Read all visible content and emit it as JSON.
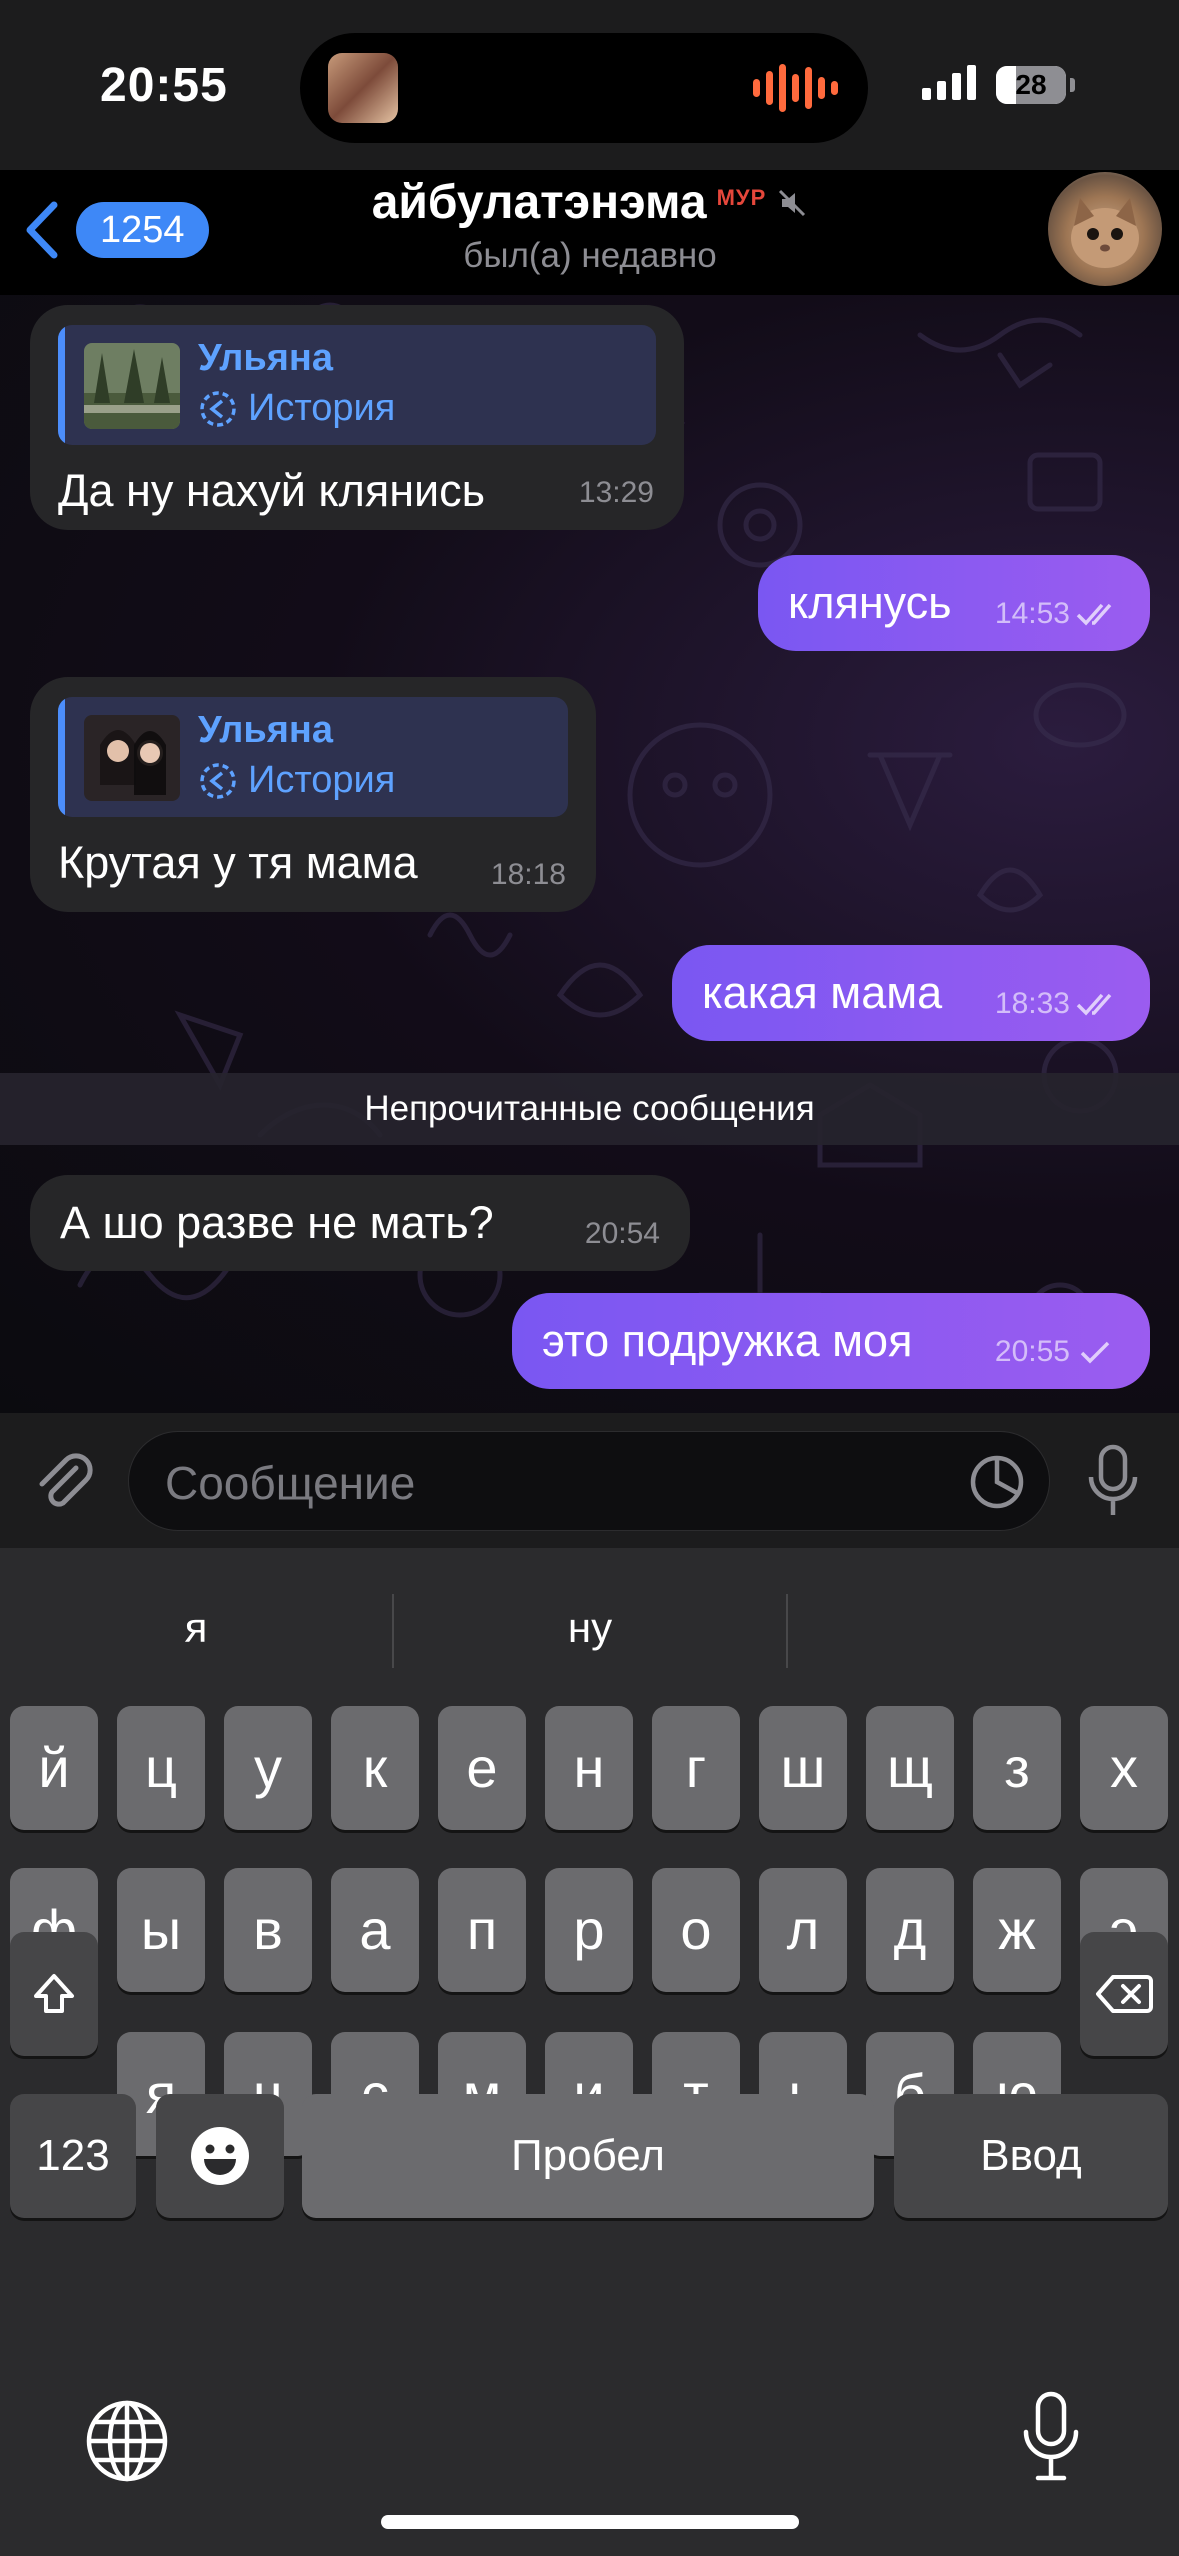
{
  "status_bar": {
    "time": "20:55",
    "battery": "28",
    "battery_level": 0.28
  },
  "header": {
    "back_count": "1254",
    "title": "айбулатэнэма",
    "tag": "МУР",
    "subtitle": "был(а) недавно"
  },
  "messages": [
    {
      "direction": "in",
      "reply_name": "Ульяна",
      "reply_type": "История",
      "text": "Да ну нахуй клянись",
      "time": "13:29"
    },
    {
      "direction": "out",
      "text": "клянусь",
      "time": "14:53",
      "status": "read"
    },
    {
      "direction": "in",
      "reply_name": "Ульяна",
      "reply_type": "История",
      "text": "Крутая у тя мама",
      "time": "18:18"
    },
    {
      "direction": "out",
      "text": "какая мама",
      "time": "18:33",
      "status": "read"
    },
    {
      "direction": "in",
      "text": "А шо разве не мать?",
      "time": "20:54"
    },
    {
      "direction": "out",
      "text": "это подружка моя",
      "time": "20:55",
      "status": "sent"
    }
  ],
  "unread_divider": "Непрочитанные сообщения",
  "input": {
    "placeholder": "Сообщение"
  },
  "keyboard": {
    "suggestions": [
      "я",
      "ну",
      ""
    ],
    "row1": [
      "й",
      "ц",
      "у",
      "к",
      "е",
      "н",
      "г",
      "ш",
      "щ",
      "з",
      "х"
    ],
    "row2": [
      "ф",
      "ы",
      "в",
      "а",
      "п",
      "р",
      "о",
      "л",
      "д",
      "ж",
      "э"
    ],
    "row3": [
      "я",
      "ч",
      "с",
      "м",
      "и",
      "т",
      "ь",
      "б",
      "ю"
    ],
    "numbers_key": "123",
    "space_key": "Пробел",
    "return_key": "Ввод"
  },
  "colors": {
    "accent": "#3e88f7",
    "outgoing_bubble": "#8a5af2",
    "incoming_bubble": "#262628",
    "reply_name": "#5ea2ff",
    "scam_tag": "#e5473b"
  },
  "icons": [
    "back-chevron-icon",
    "mute-icon",
    "story-icon",
    "read-ticks-icon",
    "attach-icon",
    "sticker-icon",
    "voice-icon",
    "shift-icon",
    "backspace-icon",
    "emoji-icon",
    "globe-icon",
    "dictation-icon"
  ]
}
